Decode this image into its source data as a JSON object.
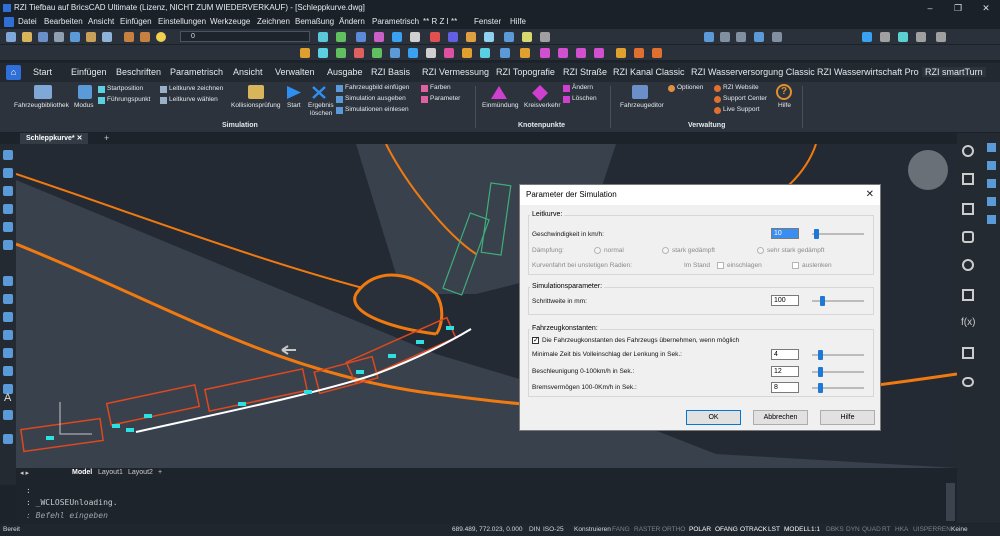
{
  "app": {
    "title": "RZI Tiefbau auf BricsCAD Ultimate (Lizenz, NICHT ZUM WIEDERVERKAUF) - [Schleppkurve.dwg]"
  },
  "menu": [
    "Datei",
    "Bearbeiten",
    "Ansicht",
    "Einfügen",
    "Einstellungen",
    "Werkzeuge",
    "Zeichnen",
    "Bemaßung",
    "Ändern",
    "Parametrisch",
    "** R Z I **",
    "Fenster",
    "Hilfe"
  ],
  "toolbar": {
    "layer_value": "0"
  },
  "ribbon_tabs": [
    "Start",
    "Einfügen",
    "Beschriften",
    "Parametrisch",
    "Ansicht",
    "Verwalten",
    "Ausgabe",
    "RZI Basis",
    "RZI Vermessung",
    "RZI Topografie",
    "RZI Straße",
    "RZI Kanal Classic",
    "RZI Wasserversorgung Classic",
    "RZI Wasserwirtschaft Pro",
    "RZI smartTurn"
  ],
  "ribbon": {
    "fahrzeugbibliothek": "Fahrzeugbibliothek",
    "modus": "Modus",
    "startposition": "Startposition",
    "fuehrungspunkt": "Führungspunkt",
    "leitkurve_zeichnen": "Leitkurve zeichnen",
    "leitkurve_waehlen": "Leitkurve wählen",
    "kollisionspruefung": "Kollisionsprüfung",
    "start": "Start",
    "ergebnis1": "Ergebnis",
    "ergebnis2": "löschen",
    "fahrzeugbild": "Fahrzeugbild einfügen",
    "sim_ausgeben": "Simulation ausgeben",
    "sim_einlesen": "Simulationen einlesen",
    "farben": "Farben",
    "parameter": "Parameter",
    "einmuendung": "Einmündung",
    "kreisverkehr": "Kreisverkehr",
    "aendern": "Ändern",
    "loeschen": "Löschen",
    "fahrzeugeditor": "Fahrzeugeditor",
    "optionen": "Optionen",
    "website": "RZI Website",
    "support": "Support Center",
    "live": "Live Support",
    "hilfe": "Hilfe",
    "group_simulation": "Simulation",
    "group_knoten": "Knotenpunkte",
    "group_verwaltung": "Verwaltung"
  },
  "doc_tab": "Schleppkurve*",
  "layout_tabs": [
    "Model",
    "Layout1",
    "Layout2",
    "+"
  ],
  "command": {
    "line1": ": ",
    "line2": ": _WCLOSEUnloading.",
    "prompt": ": Befehl eingeben"
  },
  "status": {
    "ready": "Bereit",
    "coords": "689.489, 772.023, 0.000",
    "din": "DIN",
    "iso": "ISO-25",
    "mode": "Konstruieren",
    "toggles": [
      "FANG",
      "RASTER",
      "ORTHO",
      "POLAR",
      "OFANG",
      "OTRACK",
      "LST",
      "MODELL",
      "1:1",
      "DBKS",
      "DYN",
      "QUAD",
      "RT",
      "HKA",
      "UISPERREN",
      "Keine"
    ]
  },
  "dialog": {
    "title": "Parameter der Simulation",
    "leitkurve": "Leitkurve:",
    "geschw_label": "Geschwindigkeit in km/h:",
    "geschw_value": "10",
    "daempfung": "Dämpfung:",
    "normal": "normal",
    "stark": "stark gedämpft",
    "sehr": "sehr stark gedämpft",
    "kurvenfahrt": "Kurvenfahrt bei unstetigen Radien:",
    "imstand": "Im Stand",
    "einschlagen": "einschlagen",
    "auslenken": "auslenken",
    "simparam": "Simulationsparameter:",
    "schrittweite": "Schrittweite in mm:",
    "schrittweite_value": "100",
    "fahrzeugkonst": "Fahrzeugkonstanten:",
    "uebernehmen": "Die Fahrzeugkonstanten des Fahrzeugs übernehmen, wenn möglich",
    "minzeit": "Minimale Zeit bis Volleinschlag der Lenkung in Sek.:",
    "minzeit_value": "4",
    "beschl": "Beschleunigung 0-100km/h in Sek.:",
    "beschl_value": "12",
    "brems": "Bremsvermögen 100-0Km/h in Sek.:",
    "brems_value": "8",
    "ok": "OK",
    "abbrechen": "Abbrechen",
    "hilfe": "Hilfe"
  },
  "colors": {
    "accent": "#2f6fd8",
    "curb": "#f07a10",
    "truck": "#e0481e",
    "cyan": "#2fe0e0",
    "green": "#3fae7a"
  }
}
